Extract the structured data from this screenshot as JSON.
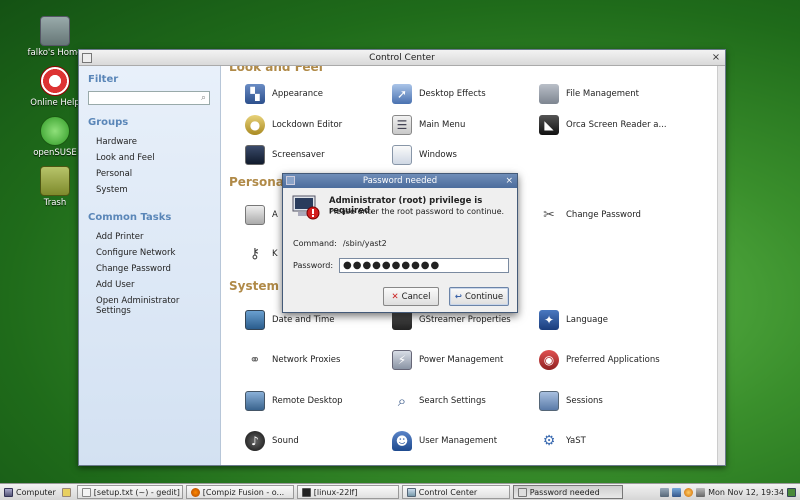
{
  "desktop": {
    "icons": [
      {
        "label": "falko's Home"
      },
      {
        "label": "Online Help"
      },
      {
        "label": "openSUSE"
      },
      {
        "label": "Trash"
      }
    ]
  },
  "window": {
    "title": "Control Center",
    "close_glyph": "×"
  },
  "sidebar": {
    "filter_heading": "Filter",
    "filter_placeholder": "",
    "groups_heading": "Groups",
    "groups": [
      "Hardware",
      "Look and Feel",
      "Personal",
      "System"
    ],
    "tasks_heading": "Common Tasks",
    "tasks": [
      "Add Printer",
      "Configure Network",
      "Change Password",
      "Add User",
      "Open Administrator Settings"
    ]
  },
  "sections": {
    "look_and_feel": "Look and Feel",
    "personal": "Personal",
    "system": "System"
  },
  "items": {
    "appearance": "Appearance",
    "desktop_effects": "Desktop Effects",
    "file_management": "File Management",
    "lockdown_editor": "Lockdown Editor",
    "main_menu": "Main Menu",
    "orca": "Orca Screen Reader a...",
    "screensaver": "Screensaver",
    "windows": "Windows",
    "personal_a": "A",
    "personal_k": "K",
    "change_password": "Change Password",
    "date_time": "Date and Time",
    "gstreamer": "GStreamer Properties",
    "language": "Language",
    "network_proxies": "Network Proxies",
    "power_management": "Power Management",
    "preferred_apps": "Preferred Applications",
    "remote_desktop": "Remote Desktop",
    "search_settings": "Search Settings",
    "sessions": "Sessions",
    "sound": "Sound",
    "user_management": "User Management",
    "yast": "YaST"
  },
  "dialog": {
    "title": "Password needed",
    "heading": "Administrator (root) privilege is required.",
    "subtext": "Please enter the root password to continue.",
    "command_label": "Command:",
    "command_value": "/sbin/yast2",
    "password_label": "Password:",
    "password_value": "●●●●●●●●●●",
    "cancel_label": "Cancel",
    "continue_label": "Continue"
  },
  "taskbar": {
    "start_label": "Computer",
    "tasks": [
      "[setup.txt (~) - gedit]",
      "[Compiz Fusion - o...",
      "[linux-22lf]",
      "Control Center",
      "Password needed"
    ],
    "clock": "Mon Nov 12, 19:34"
  },
  "colors": {
    "section_title": "#b08a48",
    "sidebar_heading": "#5a86b8",
    "dialog_title_bar": "#4b6c9c"
  }
}
